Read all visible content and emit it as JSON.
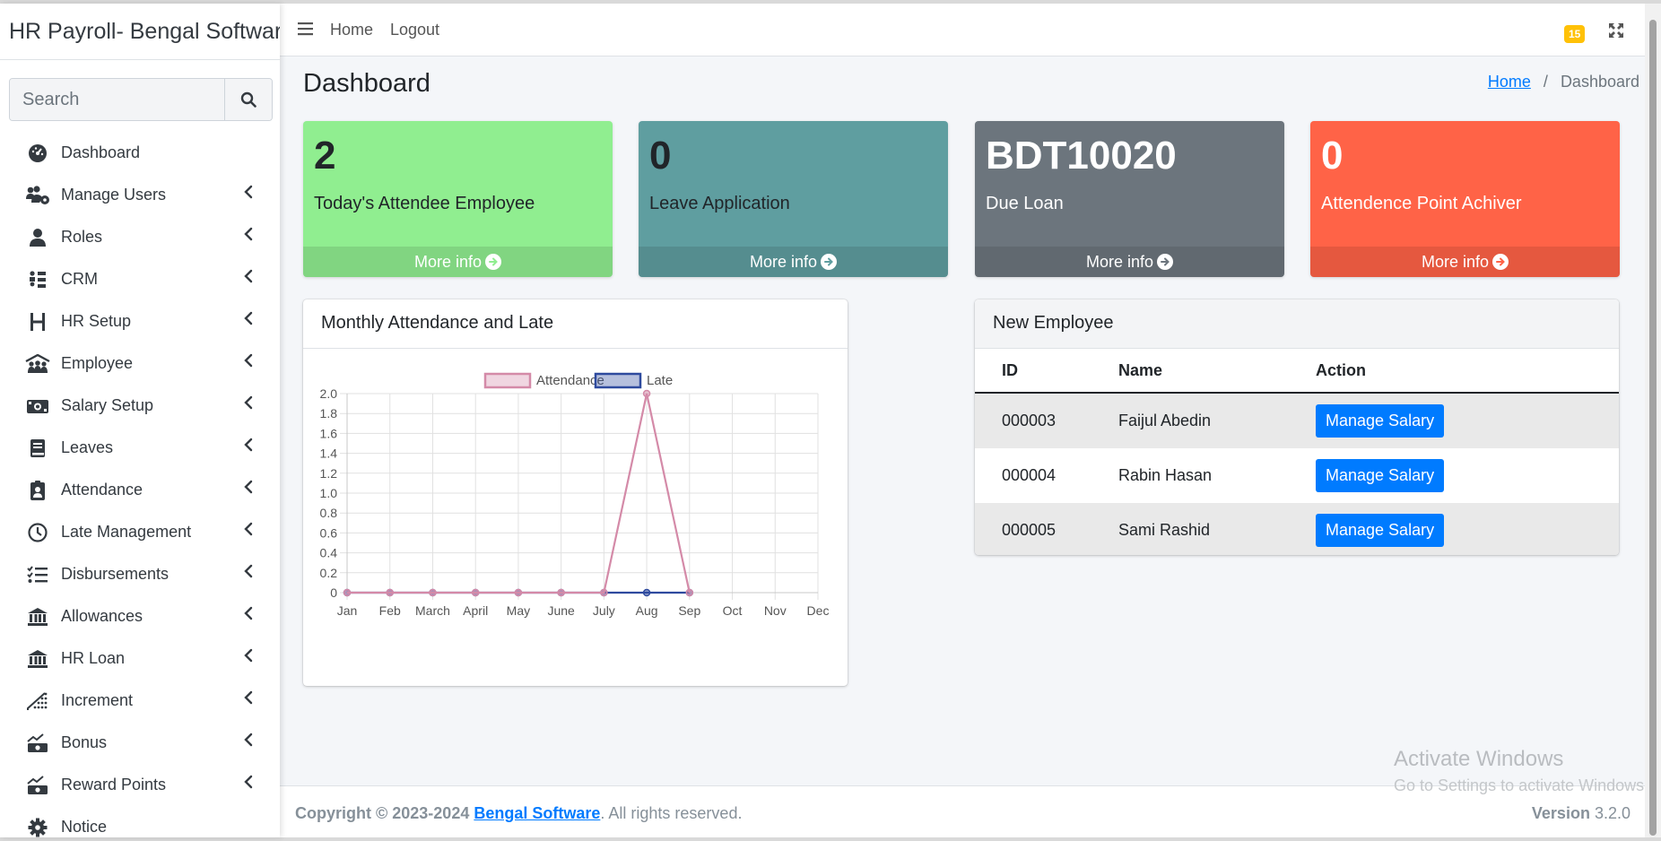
{
  "app": {
    "title": "HR Payroll- Bengal Software"
  },
  "search": {
    "placeholder": "Search"
  },
  "sidebar": {
    "items": [
      {
        "label": "Dashboard",
        "icon": "dashboard-icon",
        "has_arrow": false
      },
      {
        "label": "Manage Users",
        "icon": "users-cog-icon",
        "has_arrow": true
      },
      {
        "label": "Roles",
        "icon": "user-icon",
        "has_arrow": true
      },
      {
        "label": "CRM",
        "icon": "crm-icon",
        "has_arrow": true
      },
      {
        "label": "HR Setup",
        "icon": "h-icon",
        "has_arrow": true
      },
      {
        "label": "Employee",
        "icon": "people-roof-icon",
        "has_arrow": true
      },
      {
        "label": "Salary Setup",
        "icon": "money-icon",
        "has_arrow": true
      },
      {
        "label": "Leaves",
        "icon": "book-icon",
        "has_arrow": true
      },
      {
        "label": "Attendance",
        "icon": "id-badge-icon",
        "has_arrow": true
      },
      {
        "label": "Late Management",
        "icon": "clock-icon",
        "has_arrow": true
      },
      {
        "label": "Disbursements",
        "icon": "list-check-icon",
        "has_arrow": true
      },
      {
        "label": "Allowances",
        "icon": "bank-icon",
        "has_arrow": true
      },
      {
        "label": "HR Loan",
        "icon": "bank-icon",
        "has_arrow": true
      },
      {
        "label": "Increment",
        "icon": "chart-dots-icon",
        "has_arrow": true
      },
      {
        "label": "Bonus",
        "icon": "chart-money-icon",
        "has_arrow": true
      },
      {
        "label": "Reward Points",
        "icon": "chart-money-icon",
        "has_arrow": true
      },
      {
        "label": "Notice",
        "icon": "gear-icon",
        "has_arrow": false
      }
    ]
  },
  "topnav": {
    "home": "Home",
    "logout": "Logout",
    "notification_count": "15"
  },
  "page": {
    "title": "Dashboard"
  },
  "breadcrumb": {
    "home": "Home",
    "separator": "/",
    "current": "Dashboard"
  },
  "info_boxes": [
    {
      "value": "2",
      "label": "Today's Attendee Employee",
      "more": "More info",
      "color": "#90ee90",
      "text_color": "#212529"
    },
    {
      "value": "0",
      "label": "Leave Application",
      "more": "More info",
      "color": "#5f9ea0",
      "text_color": "#212529"
    },
    {
      "value": "BDT10020",
      "label": "Due Loan",
      "more": "More info",
      "color": "#6c757d",
      "text_color": "#ffffff"
    },
    {
      "value": "0",
      "label": "Attendence Point Achiver",
      "more": "More info",
      "color": "#ff6347",
      "text_color": "#ffffff"
    }
  ],
  "chart_card": {
    "title": "Monthly Attendance and Late"
  },
  "chart_data": {
    "type": "line",
    "x": [
      "Jan",
      "Feb",
      "March",
      "April",
      "May",
      "June",
      "July",
      "Aug",
      "Sep",
      "Oct",
      "Nov",
      "Dec"
    ],
    "series": [
      {
        "name": "Attendance",
        "values": [
          0,
          0,
          0,
          0,
          0,
          0,
          0,
          2,
          0,
          null,
          null,
          null
        ],
        "color": "#d48aa8"
      },
      {
        "name": "Late",
        "values": [
          0,
          0,
          0,
          0,
          0,
          0,
          0,
          0,
          0,
          null,
          null,
          null
        ],
        "color": "#2e4a9e"
      }
    ],
    "yticks": [
      "0",
      "0.2",
      "0.4",
      "0.6",
      "0.8",
      "1.0",
      "1.2",
      "1.4",
      "1.6",
      "1.8",
      "2.0"
    ],
    "ylim": [
      0,
      2
    ],
    "grid": true,
    "legend": "top-center"
  },
  "employees_card": {
    "title": "New Employee",
    "columns": [
      "ID",
      "Name",
      "Action"
    ],
    "rows": [
      {
        "id": "000003",
        "name": "Faijul Abedin",
        "action": "Manage Salary"
      },
      {
        "id": "000004",
        "name": "Rabin Hasan",
        "action": "Manage Salary"
      },
      {
        "id": "000005",
        "name": "Sami Rashid",
        "action": "Manage Salary"
      }
    ]
  },
  "footer": {
    "copyright": "Copyright © 2023-2024",
    "company": "Bengal Software",
    "rights": ". All rights reserved.",
    "version_label": "Version",
    "version": "3.2.0"
  },
  "watermark": {
    "line1": "Activate Windows",
    "line2": "Go to Settings to activate Windows."
  }
}
